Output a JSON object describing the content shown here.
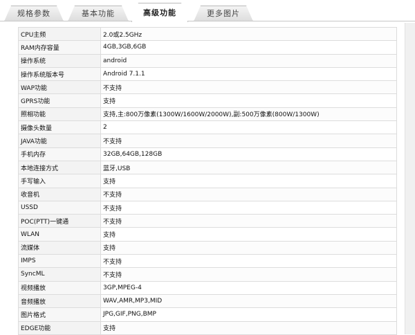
{
  "tabs": [
    {
      "label": "规格参数",
      "active": false
    },
    {
      "label": "基本功能",
      "active": false
    },
    {
      "label": "高级功能",
      "active": true
    },
    {
      "label": "更多图片",
      "active": false
    }
  ],
  "specs": [
    {
      "key": "CPU主频",
      "value": "2.0或2.5GHz"
    },
    {
      "key": "RAM内存容量",
      "value": "4GB,3GB,6GB"
    },
    {
      "key": "操作系统",
      "value": "android"
    },
    {
      "key": "操作系统版本号",
      "value": "Android 7.1.1"
    },
    {
      "key": "WAP功能",
      "value": "不支持"
    },
    {
      "key": "GPRS功能",
      "value": "支持"
    },
    {
      "key": "照相功能",
      "value": "支持,主:800万像素(1300W/1600W/2000W),副:500万像素(800W/1300W)"
    },
    {
      "key": "摄像头数量",
      "value": "2"
    },
    {
      "key": "JAVA功能",
      "value": "不支持"
    },
    {
      "key": "手机内存",
      "value": "32GB,64GB,128GB"
    },
    {
      "key": "本地连接方式",
      "value": "蓝牙,USB"
    },
    {
      "key": "手写输入",
      "value": "支持"
    },
    {
      "key": "收音机",
      "value": "不支持"
    },
    {
      "key": "USSD",
      "value": "不支持"
    },
    {
      "key": "POC(PTT)一键通",
      "value": "不支持"
    },
    {
      "key": "WLAN",
      "value": "支持"
    },
    {
      "key": "流媒体",
      "value": "支持"
    },
    {
      "key": "IMPS",
      "value": "不支持"
    },
    {
      "key": "SyncML",
      "value": "不支持"
    },
    {
      "key": "视频播放",
      "value": "3GP,MPEG-4"
    },
    {
      "key": "音频播放",
      "value": "WAV,AMR,MP3,MID"
    },
    {
      "key": "图片格式",
      "value": "JPG,GIF,PNG,BMP"
    },
    {
      "key": "EDGE功能",
      "value": "支持"
    }
  ]
}
